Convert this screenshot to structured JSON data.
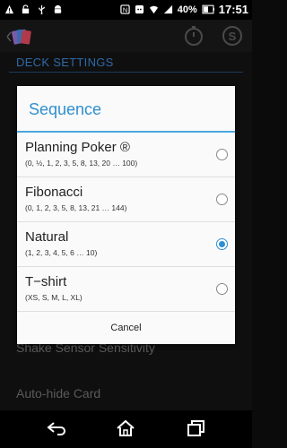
{
  "status_bar": {
    "battery_percent": "40%",
    "time": "17:51",
    "icons": [
      "warning-icon",
      "lock-icon",
      "usb-icon",
      "android-icon",
      "notification-icon",
      "cat-icon",
      "wifi-icon",
      "signal-icon",
      "battery-icon"
    ]
  },
  "action_bar": {
    "icons": [
      "app-icon",
      "timer-icon",
      "s-icon"
    ]
  },
  "background_settings": {
    "section_header": "DECK SETTINGS",
    "items": [
      "Shake Sensor Sensitivity",
      "Auto-hide Card"
    ]
  },
  "dialog": {
    "title": "Sequence",
    "options": [
      {
        "name": "Planning Poker ®",
        "values": "(0, ½, 1, 2, 3, 5, 8, 13, 20 … 100)",
        "selected": false
      },
      {
        "name": "Fibonacci",
        "values": "(0, 1, 2, 3, 5, 8, 13, 21 … 144)",
        "selected": false
      },
      {
        "name": "Natural",
        "values": "(1, 2, 3, 4, 5, 6 … 10)",
        "selected": true
      },
      {
        "name": "T−shirt",
        "values": "(XS, S, M, L, XL)",
        "selected": false
      }
    ],
    "cancel_label": "Cancel"
  },
  "nav_bar": {
    "icons": [
      "back-icon",
      "home-icon",
      "recents-icon"
    ]
  },
  "colors": {
    "accent": "#2f8fd0",
    "section_header": "#2d6aa8"
  }
}
